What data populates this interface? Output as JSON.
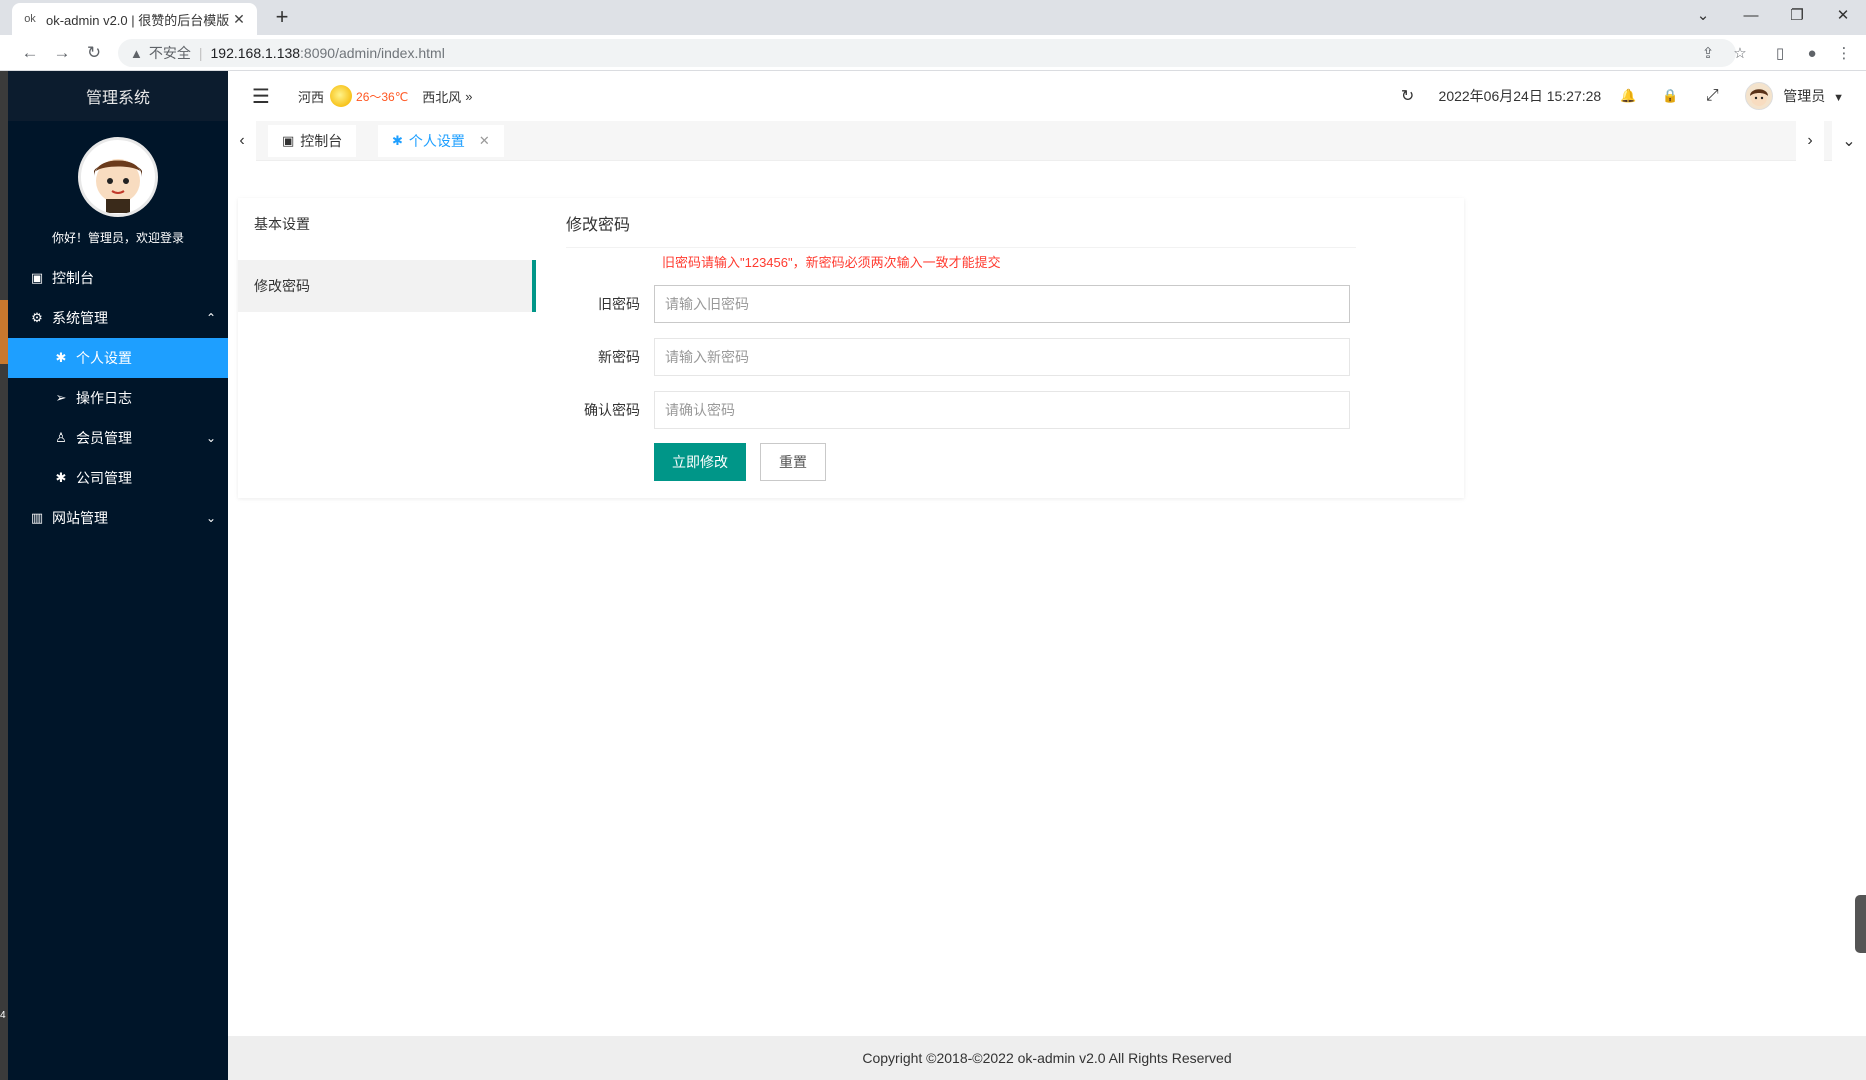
{
  "browser": {
    "tab_title": "ok-admin v2.0 | 很赞的后台模版",
    "favicon_text": "ok",
    "close_glyph": "✕",
    "new_tab_glyph": "+",
    "window_controls": {
      "minimize": "—",
      "restore": "❐",
      "close": "✕",
      "tabsearch": "⌄"
    },
    "address": {
      "insecure_label": "不安全",
      "host": "192.168.1.138",
      "path": ":8090/admin/index.html"
    },
    "nav_icons": {
      "back": "←",
      "forward": "→",
      "reload": "↻"
    },
    "toolbar_icons": {
      "share": "⇪",
      "bookmark": "☆",
      "sidepanel": "▯",
      "profile": "●",
      "menu": "⋮"
    }
  },
  "sidebar": {
    "logo": "管理系统",
    "welcome": "你好！管理员，欢迎登录",
    "items": [
      {
        "label": "控制台",
        "icon": "▣",
        "level": 1,
        "active": false
      },
      {
        "label": "系统管理",
        "icon": "⚙",
        "level": 1,
        "active": false,
        "caret": "⌃"
      },
      {
        "label": "个人设置",
        "icon": "✱",
        "level": 2,
        "active": true
      },
      {
        "label": "操作日志",
        "icon": "➢",
        "level": 2,
        "active": false
      },
      {
        "label": "会员管理",
        "icon": "♙",
        "level": 2,
        "active": false,
        "caret": "⌄"
      },
      {
        "label": "公司管理",
        "icon": "✱",
        "level": 2,
        "active": false
      },
      {
        "label": "网站管理",
        "icon": "▥",
        "level": 1,
        "active": false,
        "caret": "⌄"
      }
    ]
  },
  "header": {
    "toggle_icon": "☰",
    "weather": {
      "city": "河西",
      "temp": "26～36℃",
      "wind": "西北风",
      "more": "»"
    },
    "refresh_icon": "↻",
    "datetime": "2022年06月24日 15:27:28",
    "bell_icon": "🔔",
    "lock_icon": "🔒",
    "fullscreen_icon": "⤢",
    "admin_name": "管理员",
    "admin_caret": "▼"
  },
  "tabs": {
    "left_arrow": "‹",
    "right_arrow": "›",
    "dropdown": "⌄",
    "items": [
      {
        "label": "控制台",
        "icon": "▣",
        "active": false
      },
      {
        "label": "个人设置",
        "icon": "✱",
        "active": true,
        "close": "✕"
      }
    ]
  },
  "settings": {
    "nav": [
      "基本设置",
      "修改密码"
    ],
    "active_nav": "修改密码",
    "form_title": "修改密码",
    "tip": "旧密码请输入\"123456\"，新密码必须两次输入一致才能提交",
    "fields": [
      {
        "label": "旧密码",
        "placeholder": "请输入旧密码"
      },
      {
        "label": "新密码",
        "placeholder": "请输入新密码"
      },
      {
        "label": "确认密码",
        "placeholder": "请确认密码"
      }
    ],
    "submit": "立即修改",
    "reset": "重置"
  },
  "footer": "Copyright ©2018-©2022 ok-admin v2.0 All Rights Reserved",
  "side_marker": "4",
  "colors": {
    "sidebar_bg": "#001529",
    "active_blue": "#1e9fff",
    "primary_green": "#009688",
    "tip_red": "#ff3b30"
  }
}
